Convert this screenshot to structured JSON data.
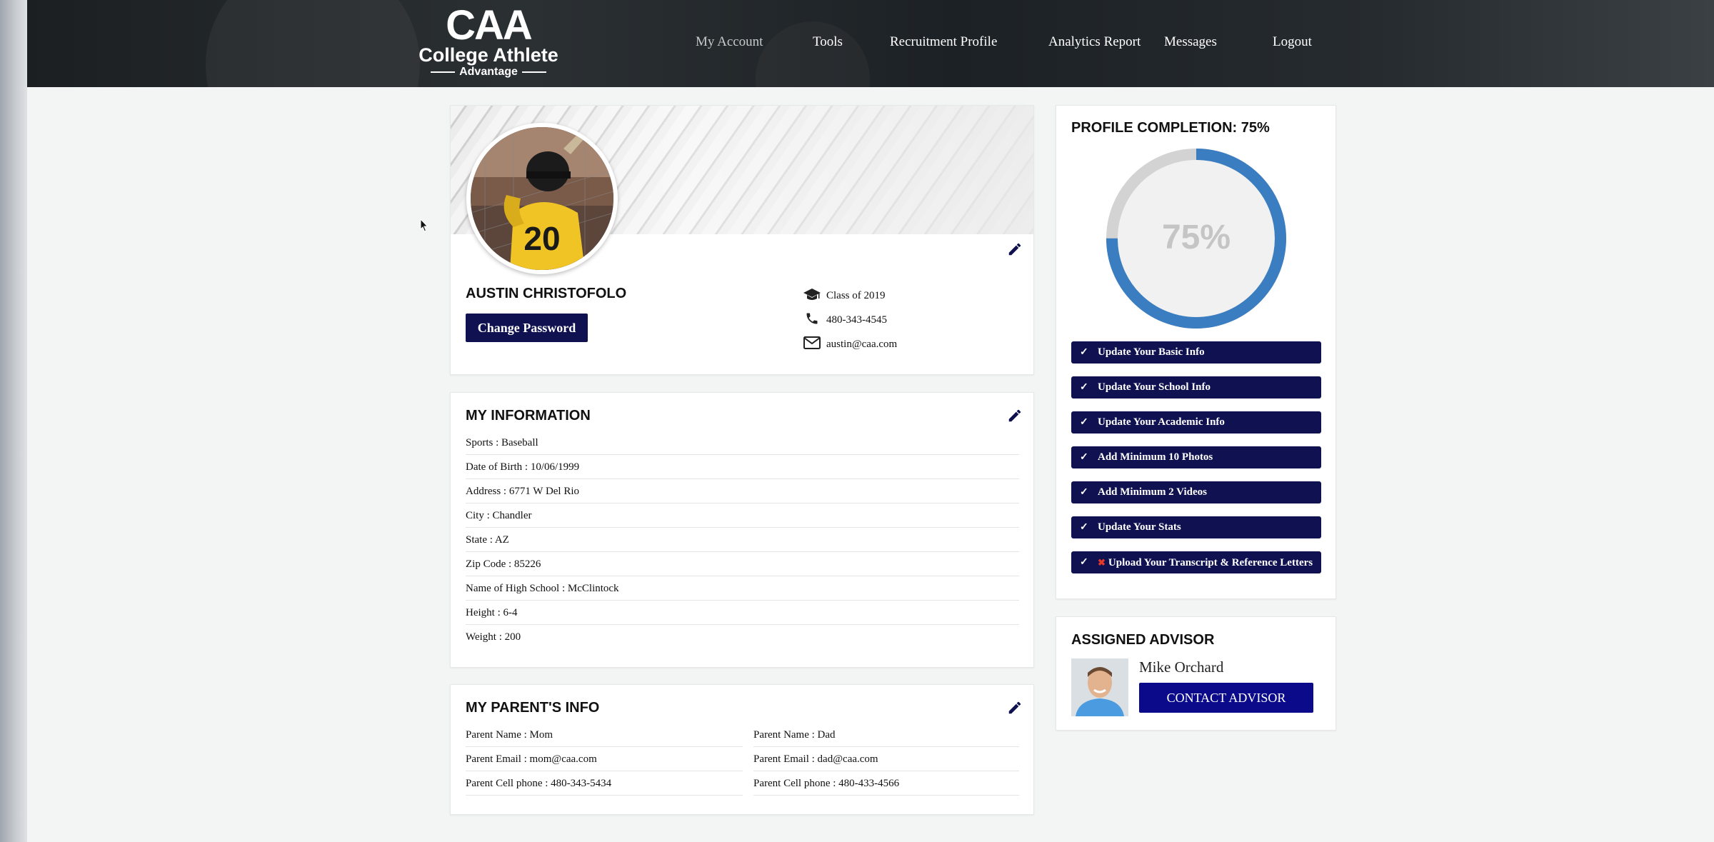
{
  "header": {
    "logo": {
      "caa": "CAA",
      "line1": "College Athlete",
      "line2": "Advantage"
    },
    "nav": [
      {
        "label": "My Account",
        "color": "#c7c9cb"
      },
      {
        "label": "Tools"
      },
      {
        "label": "Recruitment Profile"
      },
      {
        "label": "Analytics Report"
      },
      {
        "label": "Messages"
      },
      {
        "label": "Logout"
      }
    ]
  },
  "profile": {
    "name": "AUSTIN CHRISTOFOLO",
    "change_password": "Change Password",
    "class": "Class of 2019",
    "phone": "480-343-4545",
    "email": "austin@caa.com",
    "jersey_number": "20"
  },
  "my_information": {
    "title": "MY INFORMATION",
    "rows": [
      "Sports : Baseball",
      "Date of Birth : 10/06/1999",
      "Address : 6771 W Del Rio",
      "City : Chandler",
      "State : AZ",
      "Zip Code : 85226",
      "Name of High School : McClintock",
      "Height : 6-4",
      "Weight : 200"
    ]
  },
  "parents": {
    "title": "MY PARENT'S INFO",
    "left": [
      "Parent Name : Mom",
      "Parent Email : mom@caa.com",
      "Parent Cell phone : 480-343-5434"
    ],
    "right": [
      "Parent Name : Dad",
      "Parent Email : dad@caa.com",
      "Parent Cell phone : 480-433-4566"
    ]
  },
  "completion": {
    "title_prefix": "PROFILE COMPLETION:",
    "percent_label": "75%",
    "percent": 75,
    "ring_color": "#3a7dc0",
    "track_color": "#d3d3d3",
    "tasks": [
      {
        "label": "Update Your Basic Info",
        "done": true
      },
      {
        "label": "Update Your School Info",
        "done": true
      },
      {
        "label": "Update Your Academic Info",
        "done": true
      },
      {
        "label": "Add Minimum 10 Photos",
        "done": true
      },
      {
        "label": "Add Minimum 2 Videos",
        "done": true
      },
      {
        "label": "Update Your Stats",
        "done": true
      },
      {
        "label": "Upload Your Transcript & Reference Letters",
        "done": false
      }
    ]
  },
  "advisor": {
    "title": "ASSIGNED ADVISOR",
    "name": "Mike Orchard",
    "contact_button": "CONTACT ADVISOR"
  },
  "colors": {
    "brand_navy": "#0f1150",
    "contact_button": "#0a0a8a"
  }
}
